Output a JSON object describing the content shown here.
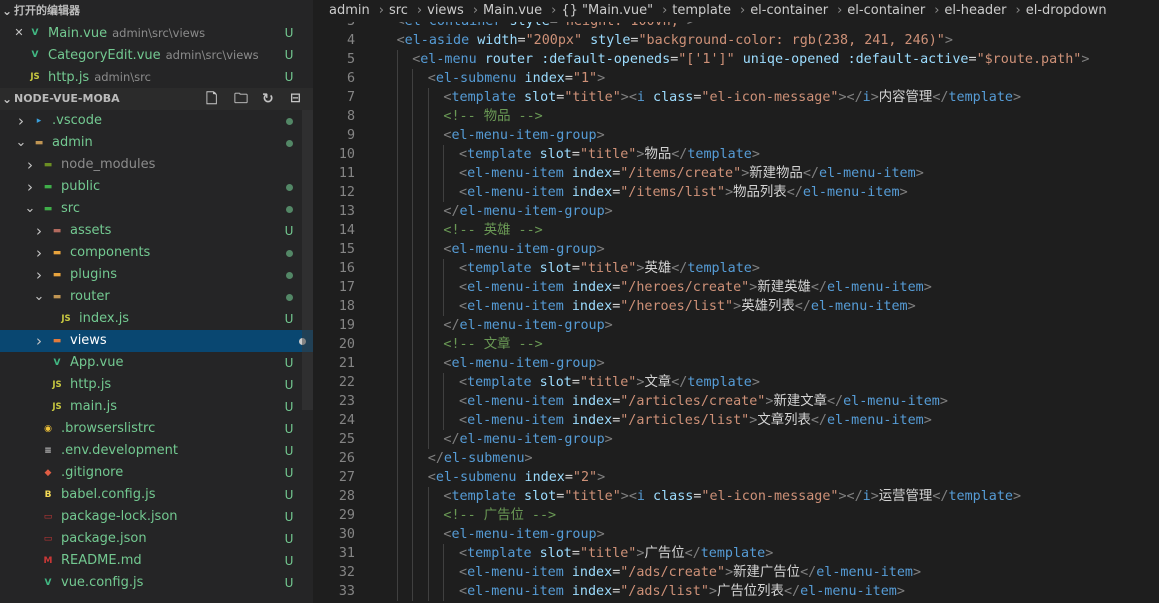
{
  "sidebar": {
    "open_editors_title": "打开的编辑器",
    "open_editors": [
      {
        "icon": "vue-file-icon",
        "name": "Main.vue",
        "path": "admin\\src\\views",
        "status": "U",
        "close": "✕"
      },
      {
        "icon": "vue-file-icon",
        "name": "CategoryEdit.vue",
        "path": "admin\\src\\views",
        "status": "U"
      },
      {
        "icon": "js-file-icon",
        "name": "http.js",
        "path": "admin\\src",
        "status": "U"
      }
    ],
    "workspace_title": "NODE-VUE-MOBA",
    "tree": [
      {
        "name": ".vscode",
        "depth": 0,
        "type": "folder",
        "open": false,
        "marker": "dot",
        "icon": "vscode-folder-icon"
      },
      {
        "name": "admin",
        "depth": 0,
        "type": "folder",
        "open": true,
        "marker": "dot",
        "icon": "folder-icon"
      },
      {
        "name": "node_modules",
        "depth": 1,
        "type": "folder",
        "open": false,
        "marker": "",
        "icon": "node-folder-icon"
      },
      {
        "name": "public",
        "depth": 1,
        "type": "folder",
        "open": false,
        "marker": "dot",
        "icon": "public-folder-icon"
      },
      {
        "name": "src",
        "depth": 1,
        "type": "folder",
        "open": true,
        "marker": "dot",
        "icon": "src-folder-icon"
      },
      {
        "name": "assets",
        "depth": 2,
        "type": "folder",
        "open": false,
        "marker": "U",
        "icon": "assets-folder-icon"
      },
      {
        "name": "components",
        "depth": 2,
        "type": "folder",
        "open": false,
        "marker": "dot",
        "icon": "components-folder-icon"
      },
      {
        "name": "plugins",
        "depth": 2,
        "type": "folder",
        "open": false,
        "marker": "dot",
        "icon": "plugins-folder-icon"
      },
      {
        "name": "router",
        "depth": 2,
        "type": "folder",
        "open": true,
        "marker": "dot",
        "icon": "folder-icon"
      },
      {
        "name": "index.js",
        "depth": 3,
        "type": "file",
        "marker": "U",
        "icon": "js-file-icon"
      },
      {
        "name": "views",
        "depth": 2,
        "type": "folder",
        "open": false,
        "marker": "dot",
        "icon": "views-folder-icon",
        "selected": true
      },
      {
        "name": "App.vue",
        "depth": 2,
        "type": "file",
        "marker": "U",
        "icon": "vue-file-icon"
      },
      {
        "name": "http.js",
        "depth": 2,
        "type": "file",
        "marker": "U",
        "icon": "js-file-icon"
      },
      {
        "name": "main.js",
        "depth": 2,
        "type": "file",
        "marker": "U",
        "icon": "js-file-icon"
      },
      {
        "name": ".browserslistrc",
        "depth": 1,
        "type": "file",
        "marker": "U",
        "icon": "browserslist-icon"
      },
      {
        "name": ".env.development",
        "depth": 1,
        "type": "file",
        "marker": "U",
        "icon": "env-file-icon"
      },
      {
        "name": ".gitignore",
        "depth": 1,
        "type": "file",
        "marker": "U",
        "icon": "git-icon"
      },
      {
        "name": "babel.config.js",
        "depth": 1,
        "type": "file",
        "marker": "U",
        "icon": "babel-icon"
      },
      {
        "name": "package-lock.json",
        "depth": 1,
        "type": "file",
        "marker": "U",
        "icon": "npm-icon"
      },
      {
        "name": "package.json",
        "depth": 1,
        "type": "file",
        "marker": "U",
        "icon": "npm-icon"
      },
      {
        "name": "README.md",
        "depth": 1,
        "type": "file",
        "marker": "U",
        "icon": "markdown-icon"
      },
      {
        "name": "vue.config.js",
        "depth": 1,
        "type": "file",
        "marker": "U",
        "icon": "vue-file-icon"
      }
    ],
    "toolbar_icons": [
      "new-file-icon",
      "new-folder-icon",
      "refresh-icon",
      "collapse-all-icon"
    ]
  },
  "breadcrumb": [
    "admin",
    "src",
    "views",
    "Main.vue",
    "{} \"Main.vue\"",
    "template",
    "el-container",
    "el-container",
    "el-header",
    "el-dropdown"
  ],
  "code": {
    "partial_first_line": "<el-container style=\"height: 100vh;\">",
    "lines": [
      {
        "n": "3",
        "indent": 1,
        "raw": "<el-container style=\"height: 100vh;\">"
      },
      {
        "n": "4",
        "indent": 1,
        "raw": "<el-aside width=\"200px\" style=\"background-color: rgb(238, 241, 246)\">"
      },
      {
        "n": "5",
        "indent": 2,
        "raw": "<el-menu router :default-openeds=\"['1']\" uniqe-opened :default-active=\"$route.path\">"
      },
      {
        "n": "6",
        "indent": 3,
        "raw": "<el-submenu index=\"1\">"
      },
      {
        "n": "7",
        "indent": 4,
        "raw": "<template slot=\"title\"><i class=\"el-icon-message\"></i>内容管理</template>"
      },
      {
        "n": "8",
        "indent": 4,
        "raw": "<!-- 物品 -->"
      },
      {
        "n": "9",
        "indent": 4,
        "raw": "<el-menu-item-group>"
      },
      {
        "n": "10",
        "indent": 5,
        "raw": "<template slot=\"title\">物品</template>"
      },
      {
        "n": "11",
        "indent": 5,
        "raw": "<el-menu-item index=\"/items/create\">新建物品</el-menu-item>"
      },
      {
        "n": "12",
        "indent": 5,
        "raw": "<el-menu-item index=\"/items/list\">物品列表</el-menu-item>"
      },
      {
        "n": "13",
        "indent": 4,
        "raw": "</el-menu-item-group>"
      },
      {
        "n": "14",
        "indent": 4,
        "raw": "<!-- 英雄 -->"
      },
      {
        "n": "15",
        "indent": 4,
        "raw": "<el-menu-item-group>"
      },
      {
        "n": "16",
        "indent": 5,
        "raw": "<template slot=\"title\">英雄</template>"
      },
      {
        "n": "17",
        "indent": 5,
        "raw": "<el-menu-item index=\"/heroes/create\">新建英雄</el-menu-item>"
      },
      {
        "n": "18",
        "indent": 5,
        "raw": "<el-menu-item index=\"/heroes/list\">英雄列表</el-menu-item>"
      },
      {
        "n": "19",
        "indent": 4,
        "raw": "</el-menu-item-group>"
      },
      {
        "n": "20",
        "indent": 4,
        "raw": "<!-- 文章 -->"
      },
      {
        "n": "21",
        "indent": 4,
        "raw": "<el-menu-item-group>"
      },
      {
        "n": "22",
        "indent": 5,
        "raw": "<template slot=\"title\">文章</template>"
      },
      {
        "n": "23",
        "indent": 5,
        "raw": "<el-menu-item index=\"/articles/create\">新建文章</el-menu-item>"
      },
      {
        "n": "24",
        "indent": 5,
        "raw": "<el-menu-item index=\"/articles/list\">文章列表</el-menu-item>"
      },
      {
        "n": "25",
        "indent": 4,
        "raw": "</el-menu-item-group>"
      },
      {
        "n": "26",
        "indent": 3,
        "raw": "</el-submenu>"
      },
      {
        "n": "27",
        "indent": 3,
        "raw": "<el-submenu index=\"2\">"
      },
      {
        "n": "28",
        "indent": 4,
        "raw": "<template slot=\"title\"><i class=\"el-icon-message\"></i>运营管理</template>"
      },
      {
        "n": "29",
        "indent": 4,
        "raw": "<!-- 广告位 -->"
      },
      {
        "n": "30",
        "indent": 4,
        "raw": "<el-menu-item-group>"
      },
      {
        "n": "31",
        "indent": 5,
        "raw": "<template slot=\"title\">广告位</template>"
      },
      {
        "n": "32",
        "indent": 5,
        "raw": "<el-menu-item index=\"/ads/create\">新建广告位</el-menu-item>"
      },
      {
        "n": "33",
        "indent": 5,
        "raw": "<el-menu-item index=\"/ads/list\">广告位列表</el-menu-item>"
      }
    ]
  }
}
